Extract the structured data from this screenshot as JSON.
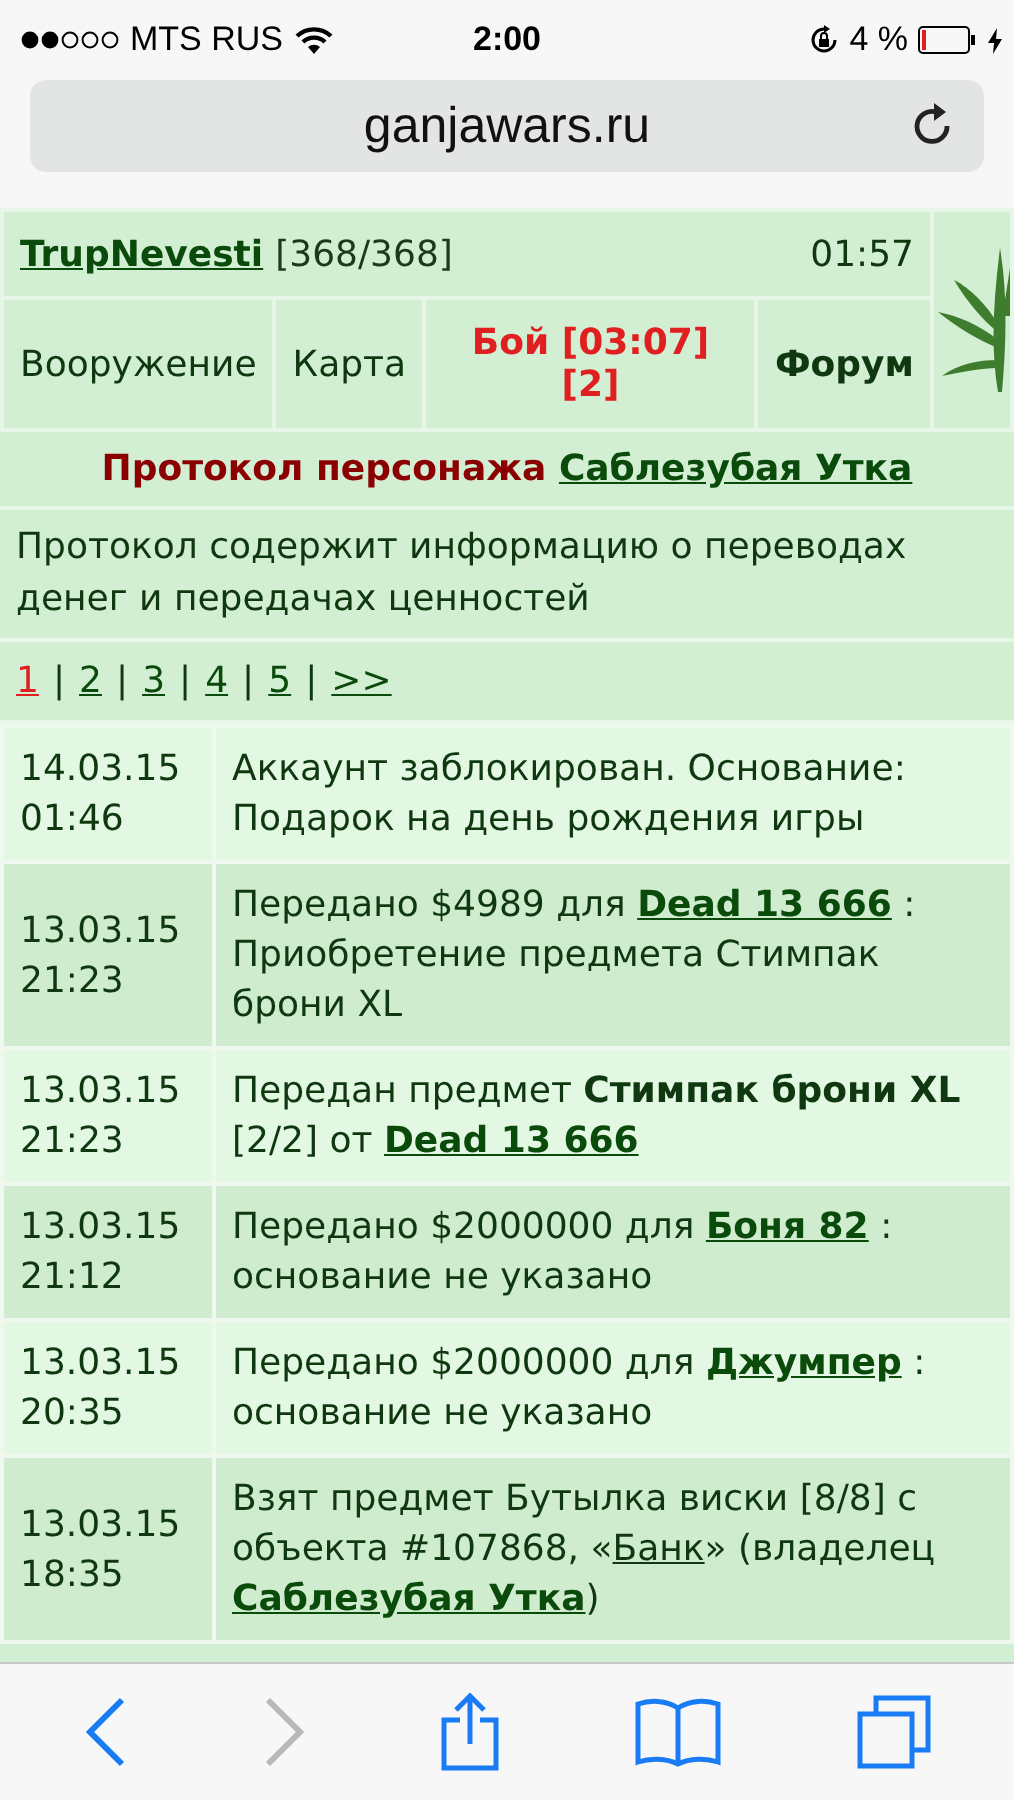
{
  "status_bar": {
    "carrier": "MTS RUS",
    "time": "2:00",
    "battery": "4 %"
  },
  "address_bar": {
    "url": "ganjawars.ru"
  },
  "header": {
    "user": "TrupNevesti",
    "hp": "[368/368]",
    "time": "01:57",
    "nav": [
      {
        "label": "Вооружение",
        "kind": "plain"
      },
      {
        "label": "Карта",
        "kind": "plain"
      },
      {
        "label": "Бой [03:07] [2]",
        "kind": "alert"
      },
      {
        "label": "Форум",
        "kind": "bold"
      }
    ]
  },
  "title": [
    {
      "text": "Протокол персонажа",
      "kind": "heading"
    },
    {
      "text": "Саблезубая Утка",
      "kind": "link"
    }
  ],
  "description": "Протокол содержит информацию о переводах денег и передачах ценностей",
  "page_separator": "|",
  "pages": [
    {
      "label": "1",
      "selected": true
    },
    {
      "label": "2",
      "selected": false
    },
    {
      "label": "3",
      "selected": false
    },
    {
      "label": "4",
      "selected": false
    },
    {
      "label": "5",
      "selected": false
    },
    {
      "label": ">>",
      "selected": false
    }
  ],
  "log": [
    {
      "date": "14.03.15",
      "time": "01:46",
      "text": [
        {
          "text": "Аккаунт заблокирован. Основание: Подарок на день рождения игры",
          "kind": "text"
        }
      ]
    },
    {
      "date": "13.03.15",
      "time": "21:23",
      "text": [
        {
          "text": "Передано $4989 для ",
          "kind": "text"
        },
        {
          "text": "Dead 13 666",
          "kind": "link"
        },
        {
          "text": " : Приобретение предмета Стимпак брони XL",
          "kind": "text"
        }
      ]
    },
    {
      "date": "13.03.15",
      "time": "21:23",
      "text": [
        {
          "text": "Передан предмет ",
          "kind": "text"
        },
        {
          "text": "Стимпак брони XL",
          "kind": "bold"
        },
        {
          "text": " [2/2] от ",
          "kind": "text"
        },
        {
          "text": "Dead 13 666",
          "kind": "link"
        }
      ]
    },
    {
      "date": "13.03.15",
      "time": "21:12",
      "text": [
        {
          "text": "Передано $2000000 для ",
          "kind": "text"
        },
        {
          "text": "Боня 82",
          "kind": "link"
        },
        {
          "text": " : основание не указано",
          "kind": "text"
        }
      ]
    },
    {
      "date": "13.03.15",
      "time": "20:35",
      "text": [
        {
          "text": "Передано $2000000 для ",
          "kind": "text"
        },
        {
          "text": "Джумпер",
          "kind": "link"
        },
        {
          "text": " : основание не указано",
          "kind": "text"
        }
      ]
    },
    {
      "date": "13.03.15",
      "time": "18:35",
      "text": [
        {
          "text": "Взят предмет Бутылка виски [8/8] с объекта #107868, «",
          "kind": "text"
        },
        {
          "text": "Банк",
          "kind": "plain_link"
        },
        {
          "text": "» (владелец ",
          "kind": "text"
        },
        {
          "text": "Саблезубая Утка",
          "kind": "link"
        },
        {
          "text": ")",
          "kind": "text"
        }
      ]
    }
  ],
  "toolbar": [
    {
      "kind": "back",
      "disabled": false
    },
    {
      "kind": "forward",
      "disabled": true
    },
    {
      "kind": "share",
      "disabled": false
    },
    {
      "kind": "bookmarks",
      "disabled": false
    },
    {
      "kind": "tabs",
      "disabled": false
    }
  ]
}
